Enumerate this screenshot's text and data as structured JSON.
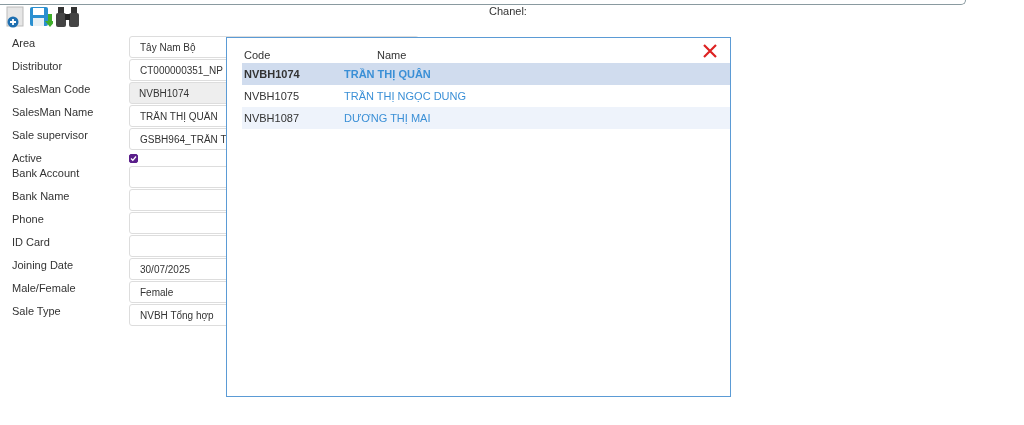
{
  "toolbar": {
    "channel_label": "Chanel:"
  },
  "form": {
    "fields": [
      {
        "label": "Area",
        "kind": "text",
        "value": "Tây Nam Bộ",
        "disabled": false
      },
      {
        "label": "Distributor",
        "kind": "text",
        "value": "CT000000351_NP",
        "disabled": false
      },
      {
        "label": "SalesMan Code",
        "kind": "text",
        "value": "NVBH1074",
        "disabled": true
      },
      {
        "label": "SalesMan Name",
        "kind": "text",
        "value": "TRẦN THỊ QUÂN",
        "disabled": false
      },
      {
        "label": "Sale supervisor",
        "kind": "text",
        "value": "GSBH964_TRẦN T",
        "disabled": false
      },
      {
        "label": "Active",
        "kind": "checkbox",
        "checked": true
      },
      {
        "label": "Bank Account",
        "kind": "text",
        "disabled": false
      },
      {
        "label": "Bank Name",
        "kind": "text",
        "disabled": false
      },
      {
        "label": "Phone",
        "kind": "text",
        "disabled": false
      },
      {
        "label": "ID Card",
        "kind": "text",
        "disabled": false
      },
      {
        "label": "Joining Date",
        "kind": "text",
        "value": "30/07/2025",
        "disabled": false
      },
      {
        "label": "Male/Female",
        "kind": "text",
        "value": "Female",
        "disabled": false
      },
      {
        "label": "Sale Type",
        "kind": "text",
        "value": "NVBH Tổng hợp",
        "disabled": false
      }
    ]
  },
  "popup": {
    "columns": [
      "Code",
      "Name"
    ],
    "rows": [
      {
        "code": "NVBH1074",
        "name": "TRẦN THỊ QUÂN",
        "selected": true
      },
      {
        "code": "NVBH1075",
        "name": "TRẦN THỊ NGỌC DUNG",
        "selected": false
      },
      {
        "code": "NVBH1087",
        "name": "DƯƠNG THỊ MAI",
        "selected": false
      }
    ]
  }
}
